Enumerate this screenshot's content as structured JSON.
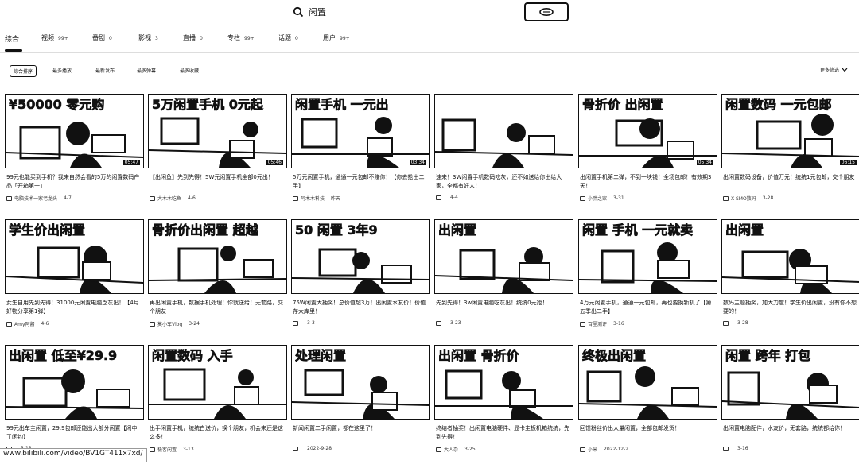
{
  "search": {
    "query": "闲置"
  },
  "tabs": [
    {
      "label": "综合",
      "count": ""
    },
    {
      "label": "视频",
      "count": "99+"
    },
    {
      "label": "番剧",
      "count": "0"
    },
    {
      "label": "影视",
      "count": "3"
    },
    {
      "label": "直播",
      "count": "0"
    },
    {
      "label": "专栏",
      "count": "99+"
    },
    {
      "label": "话题",
      "count": "0"
    },
    {
      "label": "用户",
      "count": "99+"
    }
  ],
  "filters": [
    "综合排序",
    "最多播放",
    "最新发布",
    "最多弹幕",
    "最多收藏"
  ],
  "more_filters": "更多筛选",
  "videos": [
    {
      "headline": "¥50000 零元购",
      "title": "99元也能买到手机？我来自然会看的5万的闲置数码产品「开箱第一」",
      "uploader": "电脑技术一家老龙头",
      "date": "4-7",
      "duration": "05:47"
    },
    {
      "headline": "5万闲置手机 0元起",
      "title": "【出闲鱼】先到先得！5W元闲置手机全部0元出！",
      "uploader": "大木木吃鱼",
      "date": "4-6",
      "duration": "05:46"
    },
    {
      "headline": "闲置手机 一元出",
      "title": "5万元闲置手机，通通一元包邮不赚你！【你去抢出二手】",
      "uploader": "阿木木科技",
      "date": "昨天",
      "duration": "03:34"
    },
    {
      "headline": "",
      "title": "速来！3W闲置手机数码吃灰，还不如送给你出给大家，全都有好人！",
      "uploader": "",
      "date": "4-4",
      "duration": ""
    },
    {
      "headline": "骨折价 出闲置",
      "title": "出闲置手机第二弹，不到一块钱！全场包邮！有效期3天！",
      "uploader": "小胖之家",
      "date": "3-31",
      "duration": "05:34"
    },
    {
      "headline": "闲置数码 一元包邮",
      "title": "出闲置数码设备，价值万元！统统1元包邮，交个朋友",
      "uploader": "X-SMO数码",
      "date": "3-28",
      "duration": "06:15"
    },
    {
      "headline": "学生价出闲置",
      "title": "女生自用先到先得！31000元闲置电脑乏灰出！【4月好物分享第1弹】",
      "uploader": "Amy阿酱",
      "date": "4-6",
      "duration": ""
    },
    {
      "headline": "骨折价出闲置 超越",
      "title": "再出闲置手机，数据手机处理！你就送给！无套路，交个朋友",
      "uploader": "莫小车Vlog",
      "date": "3-24",
      "duration": ""
    },
    {
      "headline": "50 闲置 3年9",
      "title": "75W闲置大抽奖！总价值超3万！出闲置水友价！价值存大库里！",
      "uploader": "",
      "date": "3-3",
      "duration": ""
    },
    {
      "headline": "出闲置",
      "title": "先到先得！3w闲置电脑吃灰出！统统0元抢！",
      "uploader": "",
      "date": "3-23",
      "duration": ""
    },
    {
      "headline": "闲置 手机 一元就卖",
      "title": "4万元闲置手机，通通一元包邮，再也要换新机了【第五季出二手】",
      "uploader": "百里测评",
      "date": "3-16",
      "duration": ""
    },
    {
      "headline": "出闲置",
      "title": "数码主题抽奖，加大力度！学生价出闲置，没有你不想要的！",
      "uploader": "",
      "date": "3-28",
      "duration": ""
    },
    {
      "headline": "出闲置 低至¥29.9",
      "title": "99元出车主闲置，29.9包邮还能出大部分闲置【闲中了闲钓】",
      "uploader": "",
      "date": "3-13",
      "duration": ""
    },
    {
      "headline": "闲置数码 入手",
      "title": "出手闲置手机，统统白送价，换个朋友，机会来还是这么多！",
      "uploader": "极客闲置",
      "date": "3-13",
      "duration": ""
    },
    {
      "headline": "处理闲置",
      "title": "新闻闲置二手闲置，都在这里了！",
      "uploader": "",
      "date": "2022-9-28",
      "duration": ""
    },
    {
      "headline": "出闲置 骨折价",
      "title": "终结者抽奖！出闲置电脑硬件、显卡主板机箱统统，先到先得！",
      "uploader": "大人杂",
      "date": "3-25",
      "duration": ""
    },
    {
      "headline": "终极出闲置",
      "title": "回馈粉丝价出大量闲置，全部包邮发货！",
      "uploader": "小米",
      "date": "2022-12-2",
      "duration": ""
    },
    {
      "headline": "闲置 跨年 打包",
      "title": "出闲置电脑配件，水友价，无套路，统统都给你！",
      "uploader": "",
      "date": "3-16",
      "duration": ""
    }
  ],
  "url_preview": "www.bilibili.com/video/BV1GT411x7xd/"
}
